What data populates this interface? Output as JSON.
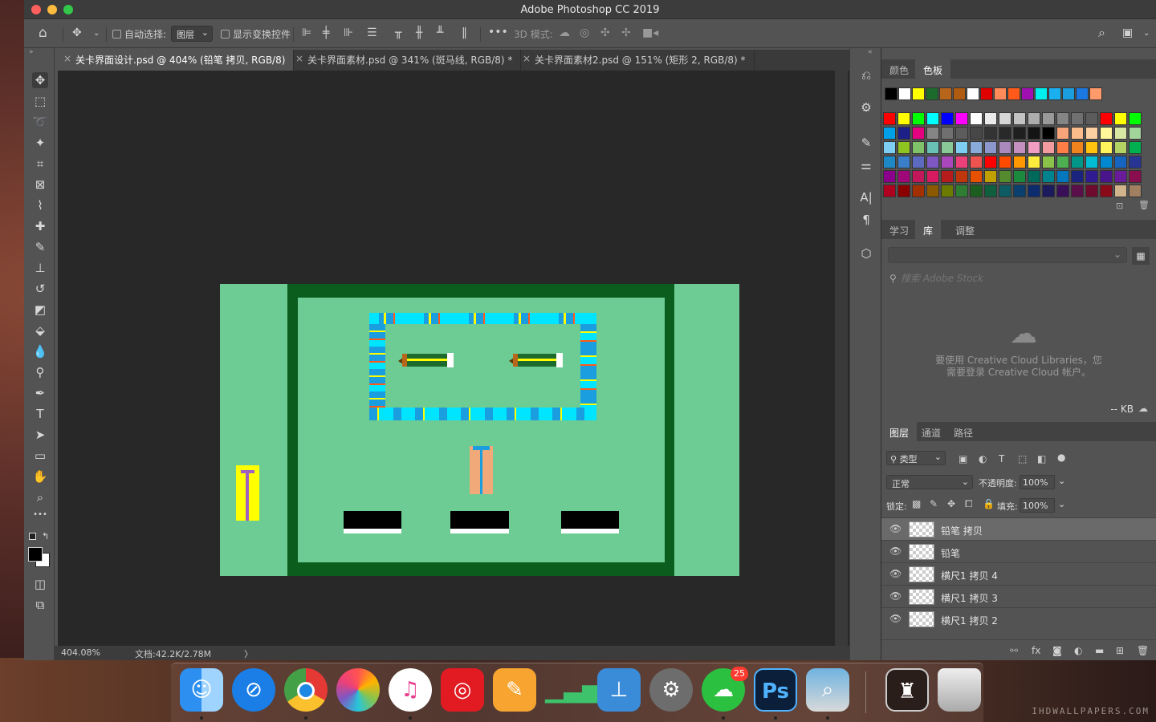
{
  "window": {
    "title": "Adobe Photoshop CC 2019"
  },
  "options": {
    "auto_select": "自动选择:",
    "layer_select": "图层",
    "show_transform": "显示变换控件",
    "mode_3d": "3D 模式:"
  },
  "tabs": [
    {
      "label": "关卡界面设计.psd @ 404% (铅笔 拷贝, RGB/8)"
    },
    {
      "label": "关卡界面素材.psd @ 341% (斑马线, RGB/8) *"
    },
    {
      "label": "关卡界面素材2.psd @ 151% (矩形 2, RGB/8) *"
    }
  ],
  "status": {
    "zoom": "404.08%",
    "doc": "文档:42.2K/2.78M",
    "arrow": "〉"
  },
  "tools": [
    "move-icon",
    "marquee-icon",
    "lasso-icon",
    "magic-wand-icon",
    "crop-icon",
    "frame-icon",
    "eyedropper-icon",
    "healing-icon",
    "brush-icon",
    "stamp-icon",
    "history-brush-icon",
    "eraser-icon",
    "bucket-icon",
    "blur-icon",
    "dodge-icon",
    "pen-icon",
    "type-icon",
    "path-select-icon",
    "rectangle-icon",
    "hand-icon",
    "zoom-icon",
    "more-icon"
  ],
  "colors_panel": {
    "tab_color": "颜色",
    "tab_swatches": "色板"
  },
  "recent_swatches": [
    "#000000",
    "#ffffff",
    "#ffff00",
    "#1c6b2c",
    "#b8651c",
    "#b05c10",
    "#ffffff",
    "#e00000",
    "#ff8a5a",
    "#ff5a1a",
    "#a010b0",
    "#00f0f0",
    "#1ab0f0",
    "#1a9ee0",
    "#1a78e0",
    "#ff9a6a"
  ],
  "swatch_rows": [
    [
      "#ff0000",
      "#ffff00",
      "#00ff00",
      "#00ffff",
      "#0000ff",
      "#ff00ff",
      "#ffffff",
      "#ebebeb",
      "#d6d6d6",
      "#c2c2c2",
      "#adadad",
      "#999999",
      "#858585",
      "#707070",
      "#5c5c5c",
      "#ff0000",
      "#ffff00",
      "#00ff00"
    ],
    [
      "#00a0e9",
      "#1d2088",
      "#e4007f",
      "#858585",
      "#707070",
      "#5c5c5c",
      "#474747",
      "#333333",
      "#292929",
      "#1f1f1f",
      "#141414",
      "#000000",
      "#f7a47a",
      "#f9bc8a",
      "#fdd0a2",
      "#fff799",
      "#d7e6a3",
      "#a3d49c"
    ],
    [
      "#7ecef4",
      "#8fc31f",
      "#80c269",
      "#69c0b4",
      "#89c997",
      "#7ecef4",
      "#88abda",
      "#8c97cb",
      "#aa89bd",
      "#c490bf",
      "#f19ec2",
      "#f29c9f",
      "#ff7e47",
      "#f0831e",
      "#ffc20e",
      "#fff45c",
      "#b3d465",
      "#00b050"
    ],
    [
      "#1e88c7",
      "#3a7ec9",
      "#5c6bc0",
      "#7e57c2",
      "#ab47bc",
      "#ec407a",
      "#ef5350",
      "#ff0000",
      "#ff4b00",
      "#ff9800",
      "#ffeb3b",
      "#8bc34a",
      "#4caf50",
      "#009688",
      "#00bcd4",
      "#0288d1",
      "#1565c0",
      "#283593"
    ],
    [
      "#8b008b",
      "#a0087a",
      "#c2185b",
      "#d81b60",
      "#b71c1c",
      "#bf360c",
      "#e65100",
      "#c0a000",
      "#558b2f",
      "#1b8a3c",
      "#00695c",
      "#00838f",
      "#0277bd",
      "#1a237e",
      "#311b92",
      "#4a148c",
      "#6a1b9a",
      "#880e4f"
    ],
    [
      "#b00020",
      "#8b0000",
      "#a23000",
      "#8b5a00",
      "#6b7b00",
      "#2e7d32",
      "#1b5e20",
      "#0f5f3f",
      "#0d5b63",
      "#0b3f6e",
      "#0d2c6e",
      "#1a1a5c",
      "#3a0f5a",
      "#5a0f4a",
      "#6e0a2e",
      "#8b0a1a",
      "#d2b48c",
      "#a08060"
    ]
  ],
  "library_panel": {
    "tab_learn": "学习",
    "tab_libraries": "库",
    "tab_adjust": "调整",
    "search_placeholder": "搜索 Adobe Stock",
    "message_line1": "要使用 Creative Cloud Libraries，您",
    "message_line2": "需要登录 Creative Cloud 帐户。",
    "size": "-- KB"
  },
  "layers_panel": {
    "tab_layers": "图层",
    "tab_channels": "通道",
    "tab_paths": "路径",
    "filter_kind": "类型",
    "blend": "正常",
    "opacity_label": "不透明度:",
    "opacity": "100%",
    "lock_label": "锁定:",
    "fill_label": "填充:",
    "fill": "100%",
    "layers": [
      {
        "name": "铅笔 拷贝",
        "selected": true
      },
      {
        "name": "铅笔",
        "selected": false
      },
      {
        "name": "横尺1 拷贝 4",
        "selected": false
      },
      {
        "name": "横尺1 拷贝 3",
        "selected": false
      },
      {
        "name": "横尺1 拷贝 2",
        "selected": false
      }
    ]
  },
  "dock": {
    "apps": [
      "finder-icon",
      "safari-icon",
      "chrome-icon",
      "photos-icon",
      "itunes-icon",
      "netease-music-icon",
      "pages-icon",
      "numbers-icon",
      "keynote-icon",
      "system-preferences-icon",
      "wechat-icon",
      "photoshop-icon",
      "preview-icon",
      "picture-icon",
      "trash-icon"
    ],
    "wechat_badge": "25",
    "photoshop_label": "Ps"
  },
  "watermark": "IHDWALLPAPERS.COM",
  "accents": {
    "art_bg": "#6dcc93",
    "art_frame": "#0b5d1e",
    "ruler_blue": "#1a9ee0",
    "ruler_cyan": "#00e5ff",
    "pencil_yellow": "#ffff00",
    "pencil_orange": "#f2a97a"
  }
}
